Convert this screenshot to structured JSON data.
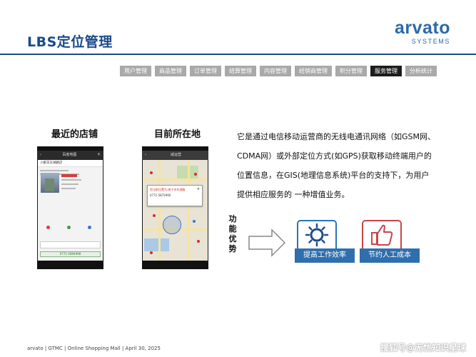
{
  "header": {
    "title": "LBS定位管理",
    "logo_main": "arvato",
    "logo_sub": "SYSTEMS"
  },
  "nav": {
    "tabs": [
      {
        "label": "用户管理"
      },
      {
        "label": "商品管理"
      },
      {
        "label": "订单管理"
      },
      {
        "label": "结算管理"
      },
      {
        "label": "内容管理"
      },
      {
        "label": "经销商管理"
      },
      {
        "label": "积分管理"
      },
      {
        "label": "服务管理",
        "active": true
      },
      {
        "label": "分析统计"
      }
    ]
  },
  "sections": {
    "nearest_store": "最近的店铺",
    "current_location": "目前所在地"
  },
  "phone1": {
    "app_title": "百度地图",
    "store_heading": "小肥羊东湖路店",
    "phone_number": "0771-5894998"
  },
  "phone2": {
    "app_title": "威运营",
    "popup_title": "您当前位置为:南宁市东湖路",
    "popup_phone": "0771-5872960"
  },
  "description": "它是通过电信移动运营商的无线电通讯网络（如GSM网、CDMA网）或外部定位方式(如GPS)获取移动终端用户的位置信息，在GIS(地理信息系统)平台的支持下，为用户提供相应服务的 一种增值业务。",
  "advantages": {
    "label": "功能优势",
    "items": [
      {
        "label": "提高工作效率",
        "icon": "sun-icon"
      },
      {
        "label": "节约人工成本",
        "icon": "thumbs-up-icon"
      }
    ]
  },
  "footer": {
    "text": "arvato | GTMC |  Online Shopping Mall | April 30, 2025",
    "watermark": "搜狐号@无忧知识星球"
  },
  "colors": {
    "brand_blue": "#1a4a8a",
    "nav_inactive": "#a9a9a9",
    "nav_active": "#1c1c1c",
    "benefit_label": "#2f6fad"
  }
}
